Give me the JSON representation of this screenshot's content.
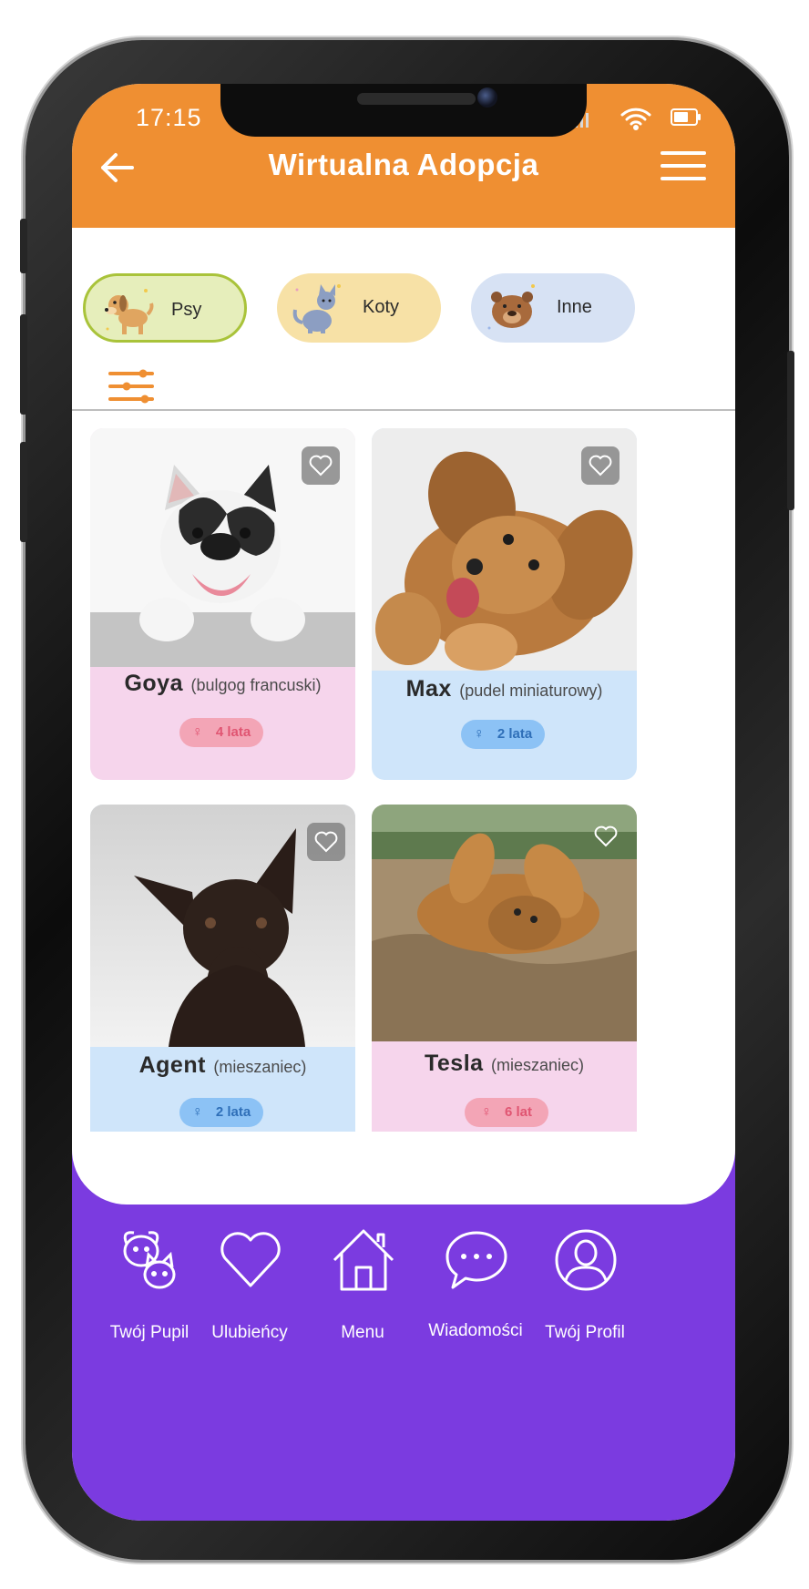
{
  "status_bar": {
    "time": "17:15"
  },
  "header": {
    "title": "Wirtualna Adopcja"
  },
  "categories": [
    {
      "label": "Psy",
      "selected": true,
      "bg": "#e6eebb",
      "border": "#a9c33a"
    },
    {
      "label": "Koty",
      "selected": false,
      "bg": "#f7e1a6"
    },
    {
      "label": "Inne",
      "selected": false,
      "bg": "#d7e2f4"
    }
  ],
  "pets": [
    {
      "name": "Goya",
      "breed": "(bulgog francuski)",
      "age": "4 lata",
      "sex": "♀",
      "card_bg": "#f6d5ec",
      "badge_bg": "#f3a5b6",
      "badge_fg": "#e05572"
    },
    {
      "name": "Max",
      "breed": "(pudel miniaturowy)",
      "age": "2 lata",
      "sex": "♀",
      "card_bg": "#cfe5fa",
      "badge_bg": "#8cc2f5",
      "badge_fg": "#2f6fb8"
    },
    {
      "name": "Agent",
      "breed": "(mieszaniec)",
      "age": "2 lata",
      "sex": "♀",
      "card_bg": "#cfe5fa",
      "badge_bg": "#8cc2f5",
      "badge_fg": "#2f6fb8"
    },
    {
      "name": "Tesla",
      "breed": "(mieszaniec)",
      "age": "6 lat",
      "sex": "♀",
      "card_bg": "#f6d5ec",
      "badge_bg": "#f3a5b6",
      "badge_fg": "#e05572"
    }
  ],
  "bottom_nav": [
    {
      "label": "Twój Pupil",
      "icon": "pets-icon"
    },
    {
      "label": "Ulubieńcy",
      "icon": "heart-icon"
    },
    {
      "label": "Menu",
      "icon": "home-icon"
    },
    {
      "label": "Wiadomości",
      "icon": "chat-bubble-icon"
    },
    {
      "label": "Twój Profil",
      "icon": "profile-icon"
    }
  ],
  "colors": {
    "header": "#ef8f32",
    "nav": "#7b3be0",
    "accent": "#ef8f32"
  }
}
